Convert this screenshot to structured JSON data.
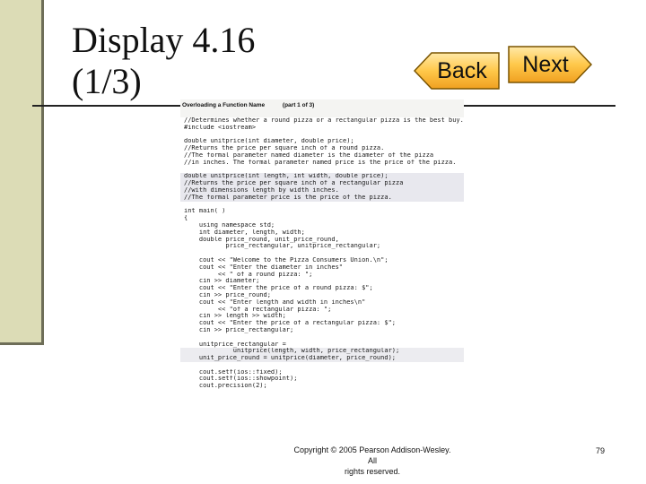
{
  "slide": {
    "title_line1": "Display 4.16",
    "title_line2": "(1/3)",
    "page_number": "79",
    "copyright_line1": "Copyright © 2005 Pearson Addison-Wesley. All",
    "copyright_line2": "rights reserved."
  },
  "nav": {
    "back_label": "Back",
    "next_label": "Next"
  },
  "code": {
    "header_title": "Overloading a Function Name",
    "header_part": "(part 1 of 3)",
    "lines": [
      "//Determines whether a round pizza or a rectangular pizza is the best buy.",
      "#include <iostream>",
      "",
      "double unitprice(int diameter, double price);",
      "//Returns the price per square inch of a round pizza.",
      "//The formal parameter named diameter is the diameter of the pizza",
      "//in inches. The formal parameter named price is the price of the pizza.",
      "",
      "double unitprice(int length, int width, double price);",
      "//Returns the price per square inch of a rectangular pizza",
      "//with dimensions length by width inches.",
      "//The formal parameter price is the price of the pizza.",
      "",
      "int main( )",
      "{",
      "    using namespace std;",
      "    int diameter, length, width;",
      "    double price_round, unit_price_round,",
      "           price_rectangular, unitprice_rectangular;",
      "",
      "    cout << \"Welcome to the Pizza Consumers Union.\\n\";",
      "    cout << \"Enter the diameter in inches\"",
      "         << \" of a round pizza: \";",
      "    cin >> diameter;",
      "    cout << \"Enter the price of a round pizza: $\";",
      "    cin >> price_round;",
      "    cout << \"Enter length and width in inches\\n\"",
      "         << \"of a rectangular pizza: \";",
      "    cin >> length >> width;",
      "    cout << \"Enter the price of a rectangular pizza: $\";",
      "    cin >> price_rectangular;",
      "",
      "    unitprice_rectangular =",
      "             unitprice(length, width, price_rectangular);",
      "    unit_price_round = unitprice(diameter, price_round);",
      "",
      "    cout.setf(ios::fixed);",
      "    cout.setf(ios::showpoint);",
      "    cout.precision(2);"
    ]
  },
  "colors": {
    "accent_bar": "#dcdcb6",
    "button_fill": "#ffd36a",
    "button_border": "#7a5400"
  }
}
